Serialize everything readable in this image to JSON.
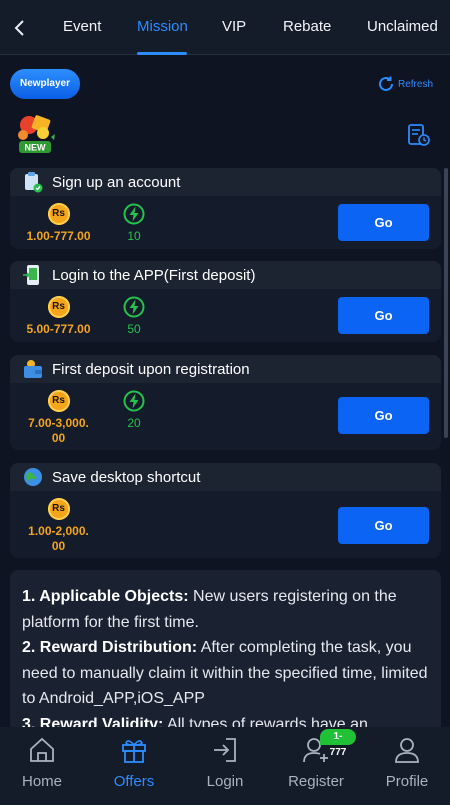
{
  "nav": {
    "tabs": [
      {
        "label": "Event"
      },
      {
        "label": "Mission"
      },
      {
        "label": "VIP"
      },
      {
        "label": "Rebate"
      },
      {
        "label": "Unclaimed"
      }
    ],
    "active_tab": "Mission"
  },
  "filters": {
    "newplayer_label": "Newplayer",
    "refresh_label": "Refresh"
  },
  "badge": {
    "icon": "new-badge-icon",
    "text": "NEW"
  },
  "currency_symbol": "Rs",
  "go_label": "Go",
  "tasks": [
    {
      "title": "Sign up an account",
      "money": "1.00-777.00",
      "points": "10",
      "icon": "clipboard-check-icon"
    },
    {
      "title": "Login to the APP(First deposit)",
      "money": "5.00-777.00",
      "points": "50",
      "icon": "phone-app-icon"
    },
    {
      "title": "First deposit upon registration",
      "money_line1": "7.00-3,000.",
      "money_line2": "00",
      "points": "20",
      "icon": "wallet-icon"
    },
    {
      "title": "Save desktop shortcut",
      "money_line1": "1.00-2,000.",
      "money_line2": "00",
      "icon": "globe-icon"
    }
  ],
  "rules": {
    "items": [
      {
        "heading": "1. Applicable Objects:",
        "text": " New users registering on the platform for the first time."
      },
      {
        "heading": "2. Reward Distribution:",
        "text": " After completing the task, you need to manually claim it within the specified time, limited to Android_APP,iOS_APP"
      },
      {
        "heading": "3. Reward Validity:",
        "text": " All types of rewards have an"
      }
    ]
  },
  "bottom_nav": {
    "items": [
      {
        "label": "Home",
        "icon": "home-icon"
      },
      {
        "label": "Offers",
        "icon": "gift-icon"
      },
      {
        "label": "Login",
        "icon": "login-icon"
      },
      {
        "label": "Register",
        "icon": "add-user-icon"
      },
      {
        "label": "Profile",
        "icon": "profile-icon"
      }
    ],
    "active": "Offers",
    "register_badge": "1-777"
  },
  "colors": {
    "accent": "#2d8cff",
    "button": "#0b64f4",
    "money": "#f5a51c",
    "points": "#27c24c",
    "background": "#0e1422"
  }
}
